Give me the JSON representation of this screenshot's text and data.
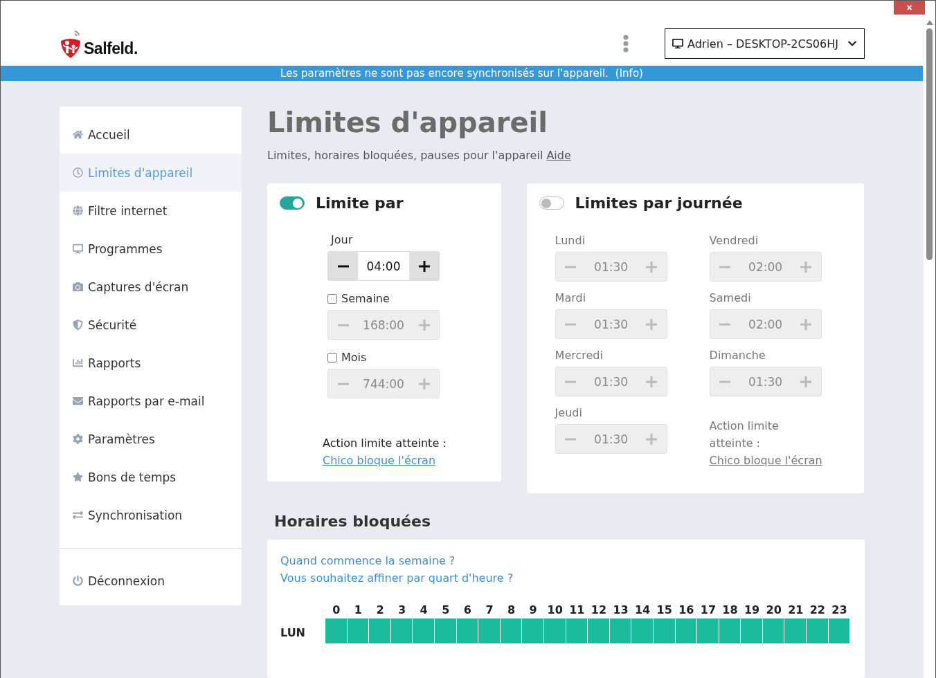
{
  "window": {
    "close": "×"
  },
  "header": {
    "logo_text": "Salfeld.",
    "device": "Adrien – DESKTOP-2CS06HJ"
  },
  "banner": {
    "message": "Les paramètres ne sont pas encore synchronisés sur l'appareil.",
    "info_link": "(Info)"
  },
  "sidebar": {
    "items": [
      {
        "label": "Accueil",
        "selected": false
      },
      {
        "label": "Limites d'appareil",
        "selected": true
      },
      {
        "label": "Filtre internet",
        "selected": false
      },
      {
        "label": "Programmes",
        "selected": false
      },
      {
        "label": "Captures d'écran",
        "selected": false
      },
      {
        "label": "Sécurité",
        "selected": false
      },
      {
        "label": "Rapports",
        "selected": false
      },
      {
        "label": "Rapports par e-mail",
        "selected": false
      },
      {
        "label": "Paramètres",
        "selected": false
      },
      {
        "label": "Bons de temps",
        "selected": false
      },
      {
        "label": "Synchronisation",
        "selected": false
      }
    ],
    "logout": "Déconnexion"
  },
  "page": {
    "title": "Limites d'appareil",
    "subtitle": "Limites, horaires bloquées, pauses pour l'appareil",
    "help_link": "Aide"
  },
  "limit_card": {
    "title": "Limite par",
    "on": true,
    "fields": [
      {
        "label": "Jour",
        "kind": "plain",
        "value": "04:00"
      },
      {
        "label": "Semaine",
        "kind": "checkbox",
        "checked": false,
        "value": "168:00"
      },
      {
        "label": "Mois",
        "kind": "checkbox",
        "checked": false,
        "value": "744:00"
      }
    ],
    "action_label": "Action limite atteinte :",
    "action_link": "Chico bloque l'écran"
  },
  "daily_card": {
    "title": "Limites par journée",
    "on": false,
    "days": [
      {
        "label": "Lundi",
        "value": "01:30"
      },
      {
        "label": "Mardi",
        "value": "01:30"
      },
      {
        "label": "Mercredi",
        "value": "01:30"
      },
      {
        "label": "Jeudi",
        "value": "01:30"
      },
      {
        "label": "Vendredi",
        "value": "02:00"
      },
      {
        "label": "Samedi",
        "value": "02:00"
      },
      {
        "label": "Dimanche",
        "value": "01:30"
      }
    ],
    "action_label": "Action limite atteinte :",
    "action_link": "Chico bloque l'écran"
  },
  "blocked": {
    "title": "Horaires bloquées",
    "links": [
      "Quand commence la semaine ?",
      "Vous souhaitez affiner par quart d'heure ?"
    ],
    "hours": [
      "0",
      "1",
      "2",
      "3",
      "4",
      "5",
      "6",
      "7",
      "8",
      "9",
      "10",
      "11",
      "12",
      "13",
      "14",
      "15",
      "16",
      "17",
      "18",
      "19",
      "20",
      "21",
      "22",
      "23"
    ],
    "rows": [
      {
        "label": "LUN",
        "allowed": [
          true,
          true,
          true,
          true,
          true,
          true,
          true,
          true,
          true,
          true,
          true,
          true,
          true,
          true,
          true,
          true,
          true,
          true,
          true,
          true,
          true,
          true,
          true,
          true
        ]
      }
    ]
  }
}
